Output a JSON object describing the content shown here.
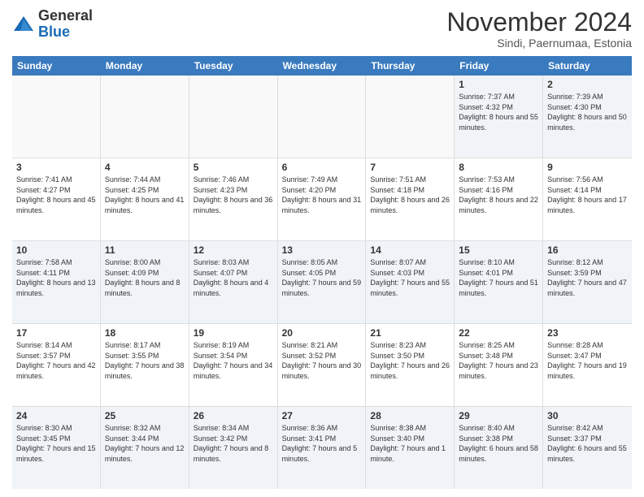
{
  "logo": {
    "general": "General",
    "blue": "Blue"
  },
  "title": "November 2024",
  "subtitle": "Sindi, Paernumaa, Estonia",
  "header": {
    "days": [
      "Sunday",
      "Monday",
      "Tuesday",
      "Wednesday",
      "Thursday",
      "Friday",
      "Saturday"
    ]
  },
  "weeks": [
    [
      {
        "day": "",
        "info": ""
      },
      {
        "day": "",
        "info": ""
      },
      {
        "day": "",
        "info": ""
      },
      {
        "day": "",
        "info": ""
      },
      {
        "day": "",
        "info": ""
      },
      {
        "day": "1",
        "info": "Sunrise: 7:37 AM\nSunset: 4:32 PM\nDaylight: 8 hours and 55 minutes."
      },
      {
        "day": "2",
        "info": "Sunrise: 7:39 AM\nSunset: 4:30 PM\nDaylight: 8 hours and 50 minutes."
      }
    ],
    [
      {
        "day": "3",
        "info": "Sunrise: 7:41 AM\nSunset: 4:27 PM\nDaylight: 8 hours and 45 minutes."
      },
      {
        "day": "4",
        "info": "Sunrise: 7:44 AM\nSunset: 4:25 PM\nDaylight: 8 hours and 41 minutes."
      },
      {
        "day": "5",
        "info": "Sunrise: 7:46 AM\nSunset: 4:23 PM\nDaylight: 8 hours and 36 minutes."
      },
      {
        "day": "6",
        "info": "Sunrise: 7:49 AM\nSunset: 4:20 PM\nDaylight: 8 hours and 31 minutes."
      },
      {
        "day": "7",
        "info": "Sunrise: 7:51 AM\nSunset: 4:18 PM\nDaylight: 8 hours and 26 minutes."
      },
      {
        "day": "8",
        "info": "Sunrise: 7:53 AM\nSunset: 4:16 PM\nDaylight: 8 hours and 22 minutes."
      },
      {
        "day": "9",
        "info": "Sunrise: 7:56 AM\nSunset: 4:14 PM\nDaylight: 8 hours and 17 minutes."
      }
    ],
    [
      {
        "day": "10",
        "info": "Sunrise: 7:58 AM\nSunset: 4:11 PM\nDaylight: 8 hours and 13 minutes."
      },
      {
        "day": "11",
        "info": "Sunrise: 8:00 AM\nSunset: 4:09 PM\nDaylight: 8 hours and 8 minutes."
      },
      {
        "day": "12",
        "info": "Sunrise: 8:03 AM\nSunset: 4:07 PM\nDaylight: 8 hours and 4 minutes."
      },
      {
        "day": "13",
        "info": "Sunrise: 8:05 AM\nSunset: 4:05 PM\nDaylight: 7 hours and 59 minutes."
      },
      {
        "day": "14",
        "info": "Sunrise: 8:07 AM\nSunset: 4:03 PM\nDaylight: 7 hours and 55 minutes."
      },
      {
        "day": "15",
        "info": "Sunrise: 8:10 AM\nSunset: 4:01 PM\nDaylight: 7 hours and 51 minutes."
      },
      {
        "day": "16",
        "info": "Sunrise: 8:12 AM\nSunset: 3:59 PM\nDaylight: 7 hours and 47 minutes."
      }
    ],
    [
      {
        "day": "17",
        "info": "Sunrise: 8:14 AM\nSunset: 3:57 PM\nDaylight: 7 hours and 42 minutes."
      },
      {
        "day": "18",
        "info": "Sunrise: 8:17 AM\nSunset: 3:55 PM\nDaylight: 7 hours and 38 minutes."
      },
      {
        "day": "19",
        "info": "Sunrise: 8:19 AM\nSunset: 3:54 PM\nDaylight: 7 hours and 34 minutes."
      },
      {
        "day": "20",
        "info": "Sunrise: 8:21 AM\nSunset: 3:52 PM\nDaylight: 7 hours and 30 minutes."
      },
      {
        "day": "21",
        "info": "Sunrise: 8:23 AM\nSunset: 3:50 PM\nDaylight: 7 hours and 26 minutes."
      },
      {
        "day": "22",
        "info": "Sunrise: 8:25 AM\nSunset: 3:48 PM\nDaylight: 7 hours and 23 minutes."
      },
      {
        "day": "23",
        "info": "Sunrise: 8:28 AM\nSunset: 3:47 PM\nDaylight: 7 hours and 19 minutes."
      }
    ],
    [
      {
        "day": "24",
        "info": "Sunrise: 8:30 AM\nSunset: 3:45 PM\nDaylight: 7 hours and 15 minutes."
      },
      {
        "day": "25",
        "info": "Sunrise: 8:32 AM\nSunset: 3:44 PM\nDaylight: 7 hours and 12 minutes."
      },
      {
        "day": "26",
        "info": "Sunrise: 8:34 AM\nSunset: 3:42 PM\nDaylight: 7 hours and 8 minutes."
      },
      {
        "day": "27",
        "info": "Sunrise: 8:36 AM\nSunset: 3:41 PM\nDaylight: 7 hours and 5 minutes."
      },
      {
        "day": "28",
        "info": "Sunrise: 8:38 AM\nSunset: 3:40 PM\nDaylight: 7 hours and 1 minute."
      },
      {
        "day": "29",
        "info": "Sunrise: 8:40 AM\nSunset: 3:38 PM\nDaylight: 6 hours and 58 minutes."
      },
      {
        "day": "30",
        "info": "Sunrise: 8:42 AM\nSunset: 3:37 PM\nDaylight: 6 hours and 55 minutes."
      }
    ]
  ]
}
